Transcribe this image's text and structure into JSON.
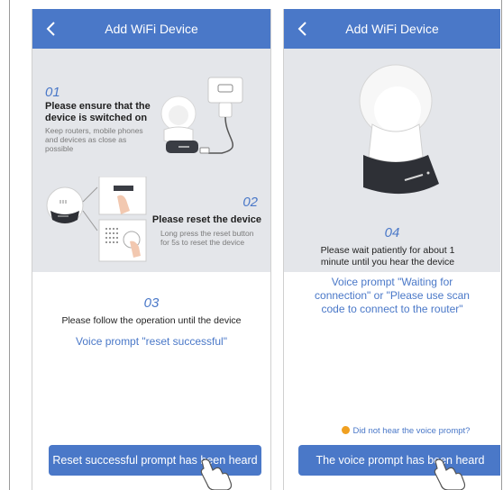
{
  "left": {
    "title": "Add WiFi Device",
    "step1": {
      "number": "01",
      "heading": "Please ensure that the device is switched on",
      "note": "Keep routers, mobile phones and devices as close as possible"
    },
    "step2": {
      "number": "02",
      "heading": "Please reset the device",
      "note": "Long press the reset button for 5s to reset the device"
    },
    "step3": {
      "number": "03",
      "instruction": "Please follow the operation until the device",
      "voice": "Voice prompt \"reset successful\""
    },
    "button": "Reset successful prompt has been heard"
  },
  "right": {
    "title": "Add WiFi Device",
    "step4": {
      "number": "04",
      "instruction": "Please wait patiently for about 1 minute until you hear the device",
      "voice": "Voice prompt \"Waiting for connection\" or \"Please use scan code to connect to the router\""
    },
    "hint": "Did not hear the voice prompt?",
    "button": "The voice prompt has been heard"
  },
  "colors": {
    "accent": "#4a78c8",
    "panel": "#e4e6ea",
    "hint_dot": "#f0a020"
  }
}
